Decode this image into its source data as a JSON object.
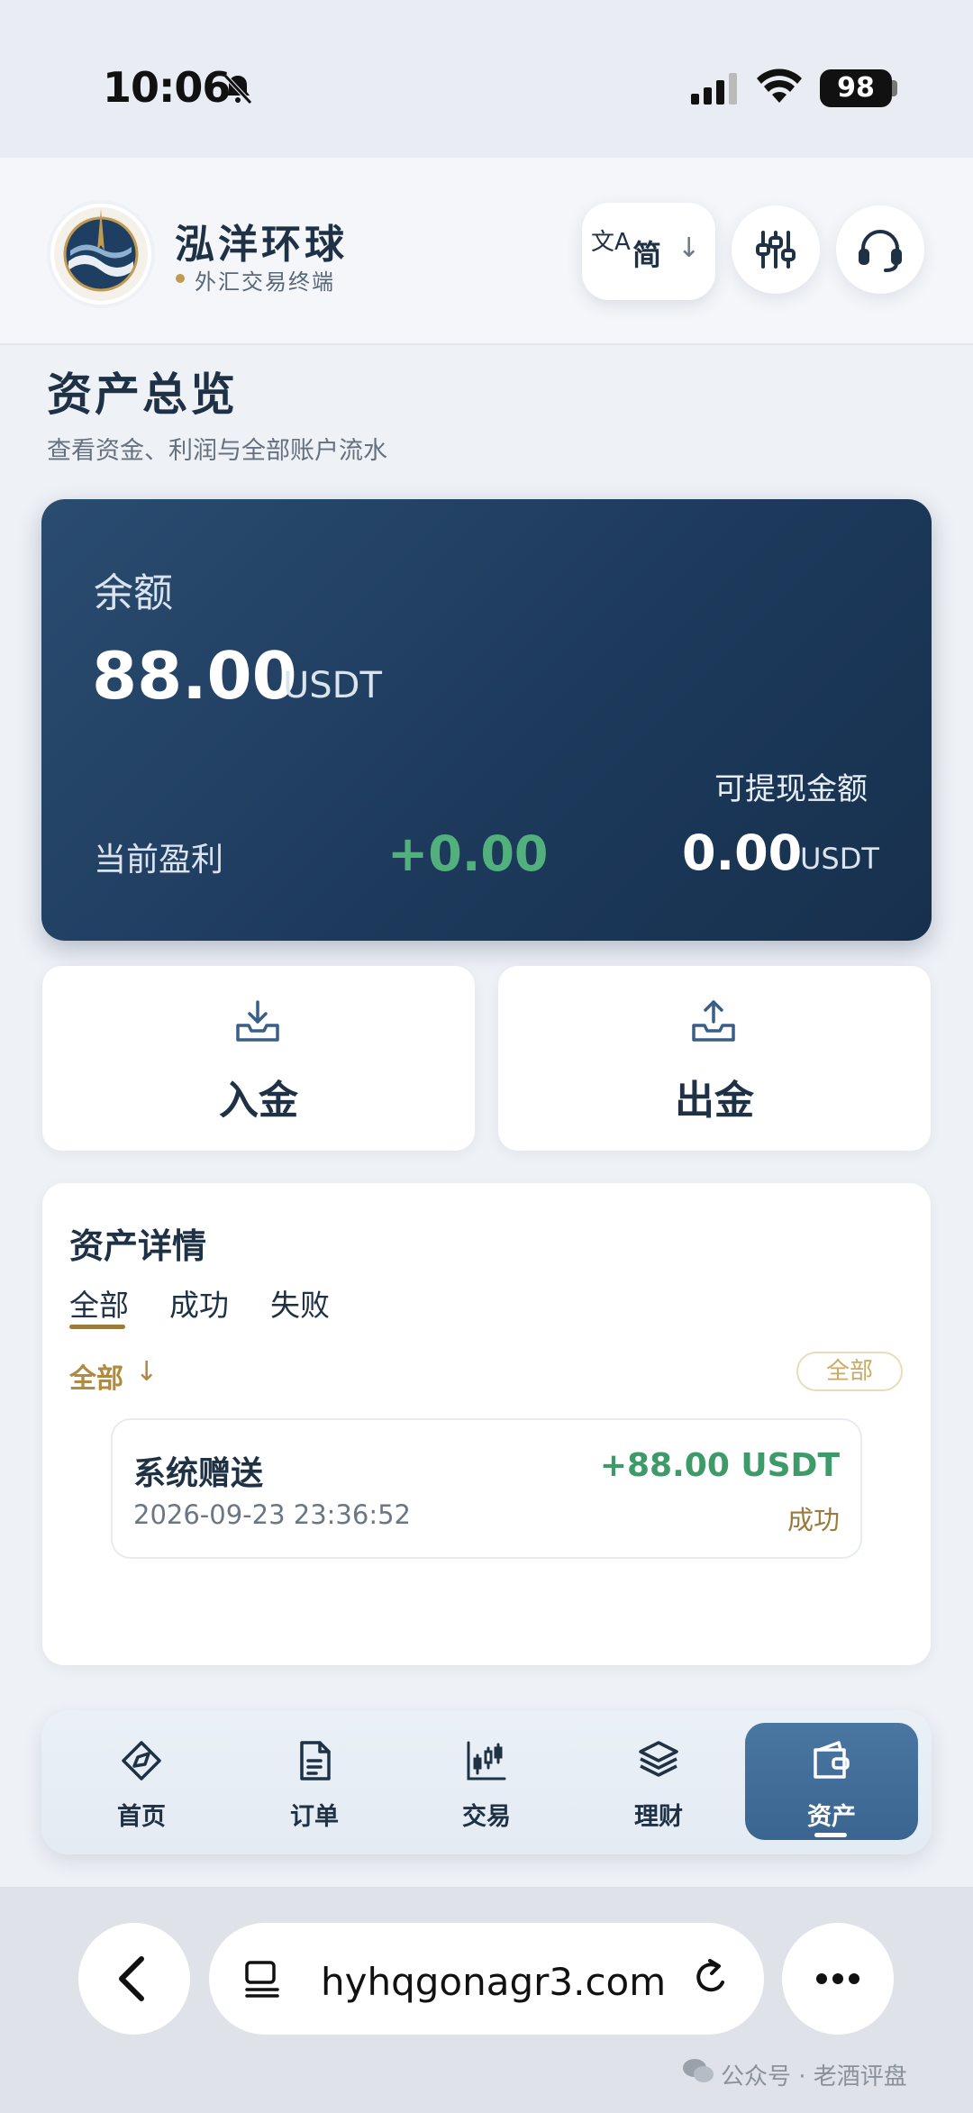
{
  "status_bar": {
    "time": "10:06",
    "battery": "98"
  },
  "header": {
    "brand_name": "泓洋环球",
    "brand_sub": "外汇交易终端",
    "lang_glyph": "文A",
    "lang_label": "简",
    "lang_arrow": "↓"
  },
  "page": {
    "title": "资产总览",
    "subtitle": "查看资金、利润与全部账户流水"
  },
  "balance": {
    "label": "余额",
    "amount": "88.00",
    "unit": "USDT",
    "profit_label": "当前盈利",
    "profit_value": "+0.00",
    "withdrawable_label": "可提现金额",
    "withdrawable_value": "0.00",
    "withdrawable_unit": "USDT"
  },
  "actions": {
    "deposit": "入金",
    "withdraw": "出金"
  },
  "detail": {
    "title": "资产详情",
    "tabs": [
      "全部",
      "成功",
      "失败"
    ],
    "filter_label": "全部",
    "filter_arrow": "↓",
    "filter_pill": "全部",
    "records": [
      {
        "title": "系统赠送",
        "time": "2026-09-23 23:36:52",
        "amount": "+88.00 USDT",
        "status": "成功"
      }
    ]
  },
  "tabbar": {
    "items": [
      {
        "label": "首页",
        "icon": "compass-icon"
      },
      {
        "label": "订单",
        "icon": "document-icon"
      },
      {
        "label": "交易",
        "icon": "candlestick-icon"
      },
      {
        "label": "理财",
        "icon": "box-icon"
      },
      {
        "label": "资产",
        "icon": "wallet-icon"
      }
    ],
    "active": "资产"
  },
  "browser": {
    "url": "hyhqgonagr3.com"
  },
  "watermark": "公众号 · 老酒评盘",
  "colors": {
    "card_bg": "#1d3a5c",
    "profit": "#52b07c",
    "gold": "#b08a3f",
    "active_tab": "#3a6590"
  }
}
